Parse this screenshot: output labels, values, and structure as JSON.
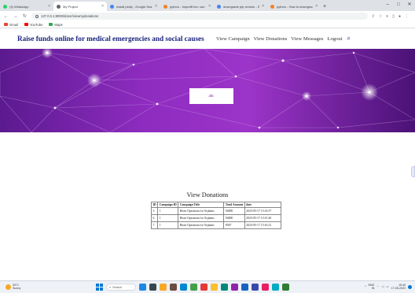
{
  "browser": {
    "tabs": [
      {
        "title": "(3) WhatsApp",
        "favicon_color": "#25d366",
        "active": false
      },
      {
        "title": "My Project",
        "favicon_color": "#5f6368",
        "active": true
      },
      {
        "title": "install plotly - Google Sea",
        "favicon_color": "#4285f4",
        "active": false
      },
      {
        "title": "python - ImportError: can",
        "favicon_color": "#f48024",
        "active": false
      },
      {
        "title": "downgrade pip version - S",
        "favicon_color": "#4285f4",
        "active": false
      },
      {
        "title": "python - How to downgrad",
        "favicon_color": "#f48024",
        "active": false
      }
    ],
    "url": "127.0.0.1:8000/donor/viewmydonations",
    "bookmarks": [
      {
        "label": "Gmail",
        "color": "#ea4335"
      },
      {
        "label": "YouTube",
        "color": "#ff0000"
      },
      {
        "label": "Maps",
        "color": "#34a853"
      }
    ]
  },
  "site": {
    "brand": "Raise funds online for medical emergencies and social causes",
    "nav": [
      "View Campaign",
      "View Donations",
      "View Messages",
      "Logout"
    ],
    "hero_box_text": "abc",
    "section_title": "View Donations",
    "table": {
      "headers": [
        "ID",
        "Campaign ID",
        "Campaign Title",
        "Total Amount",
        "date"
      ],
      "rows": [
        [
          "5",
          "1",
          "Heart Operation for Orphans",
          "94000",
          "2023-05-17 15:14:57"
        ],
        [
          "6",
          "1",
          "Heart Operation for Orphans",
          "94000",
          "2023-05-17 15:15:20"
        ],
        [
          "7",
          "1",
          "Heart Operation for Orphans",
          "8567",
          "2023-05-17 15:16:21"
        ]
      ]
    }
  },
  "taskbar": {
    "weather_temp": "30°C",
    "weather_desc": "Sunny",
    "search_label": "Search",
    "app_colors": [
      "#1e88e5",
      "#37474f",
      "#f9a825",
      "#6d4c41",
      "#0288d1",
      "#43a047",
      "#e53935",
      "#fbc02d",
      "#00897b",
      "#8e24aa",
      "#1565c0",
      "#3949ab",
      "#e91e63",
      "#00acc1",
      "#2e7d32"
    ],
    "lang_top": "ENG",
    "lang_bottom": "IN",
    "time": "15:40",
    "date": "17-05-2023"
  },
  "colors": {
    "brand": "#1a237e",
    "hero_accent": "#7a1fa2"
  }
}
